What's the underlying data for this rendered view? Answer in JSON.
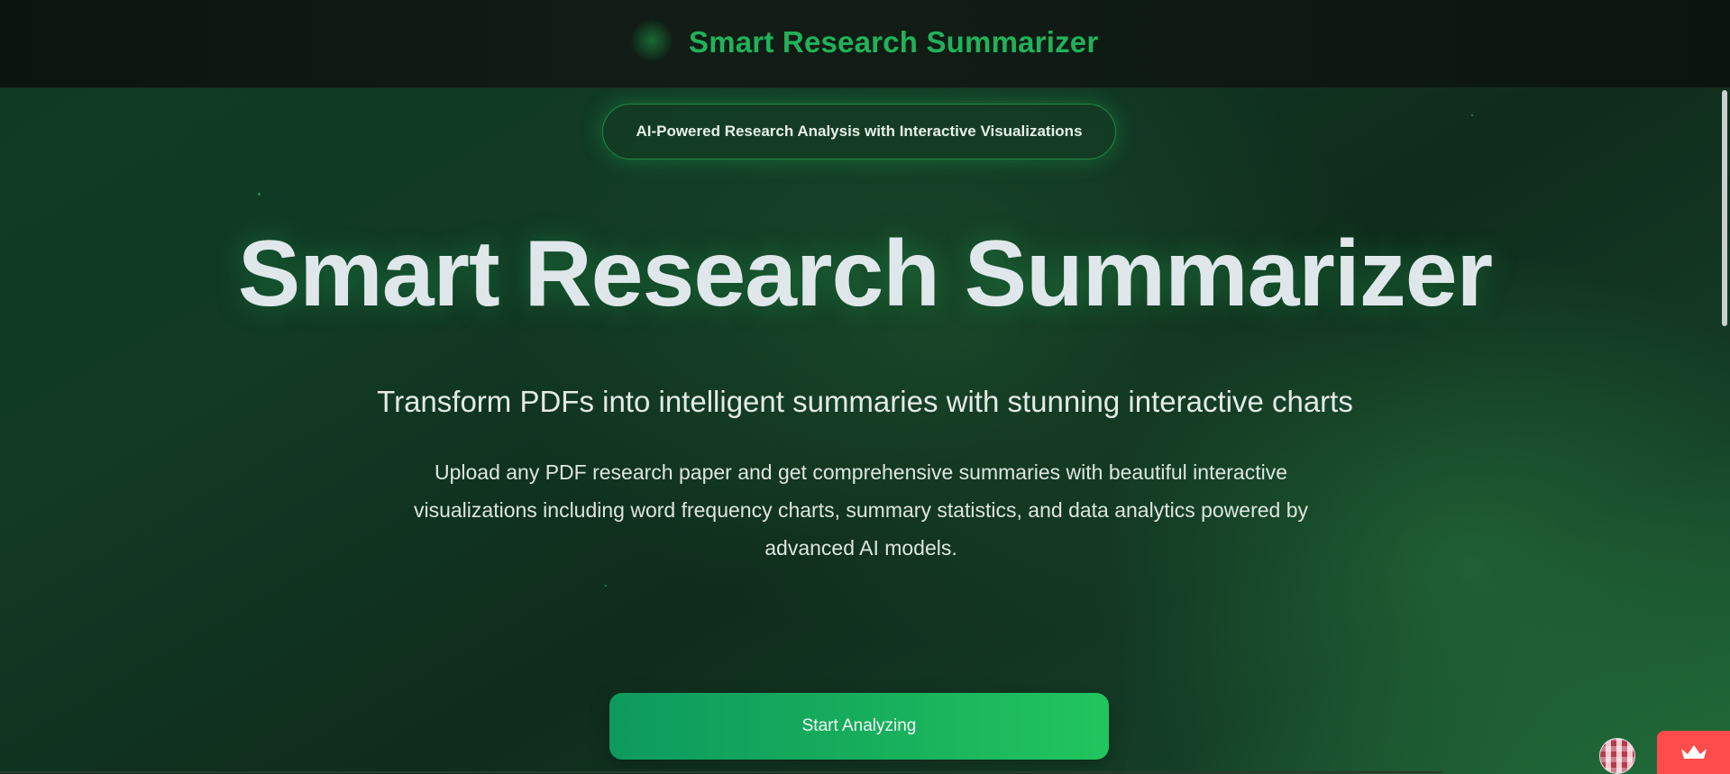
{
  "header": {
    "title": "Smart Research Summarizer"
  },
  "hero": {
    "badge": "AI-Powered Research Analysis with Interactive Visualizations",
    "title": "Smart Research Summarizer",
    "subtitle": "Transform PDFs into intelligent summaries with stunning interactive charts",
    "description": "Upload any PDF research paper and get comprehensive summaries with beautiful interactive visualizations including word frequency charts, summary statistics, and data analytics powered by advanced AI models.",
    "cta_label": "Start Analyzing"
  },
  "colors": {
    "accent": "#22c55e",
    "header_title": "#22b15a",
    "cta_start": "#0e9a5e",
    "cta_end": "#22c55e",
    "floating_button": "#ff4b4b"
  },
  "icons": {
    "floating_button": "crown-icon",
    "avatar": "user-avatar-icon"
  }
}
